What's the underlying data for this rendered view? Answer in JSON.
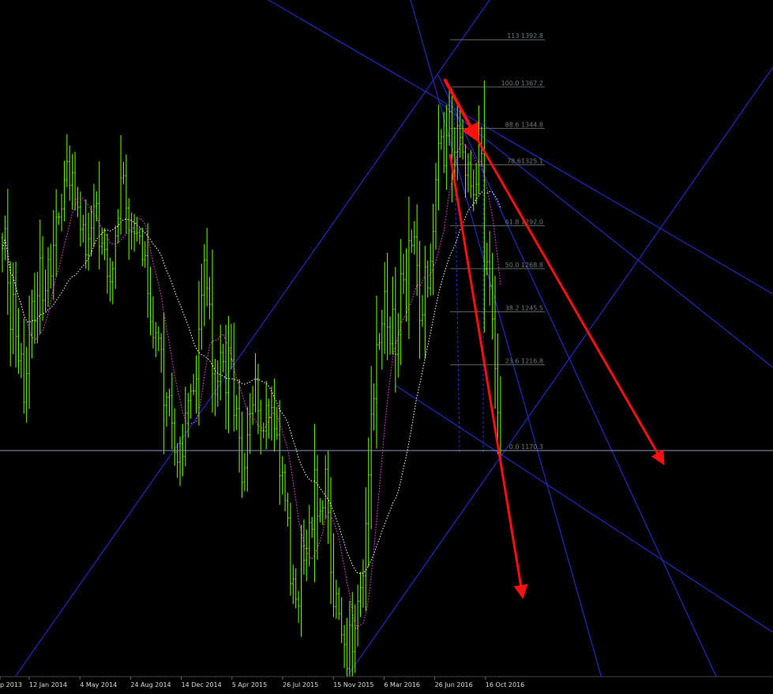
{
  "colors": {
    "background": "#000000",
    "candle": "#7CFC00",
    "ma_fast": "#FF40FF",
    "ma_slow": "#FFFFFF",
    "trendlines": "#2233DD",
    "fib_levels": "#5A6A6A",
    "fib_text": "#6B7B7B",
    "arrows": "#FF1010",
    "price_line": "#8899BB",
    "axis_text": "#DDDDDD"
  },
  "time_axis": {
    "labels": [
      "p 2013",
      "12 Jan 2014",
      "4 May 2014",
      "24 Aug 2014",
      "14 Dec 2014",
      "5 Apr 2015",
      "26 Jul 2015",
      "15 Nov 2015",
      "6 Mar 2016",
      "26 Jun 2016",
      "16 Oct 2016"
    ]
  },
  "chart_data": {
    "type": "candlestick",
    "timeframe": "weekly",
    "price_series": [
      1279.5,
      1290.4,
      1261.1,
      1236.0,
      1254.9,
      1232.1,
      1218.9,
      1222.5,
      1196.5,
      1212.0,
      1233.0,
      1251.1,
      1240.4,
      1254.1,
      1274.6,
      1251.7,
      1256.9,
      1273.9,
      1264.8,
      1281.5,
      1296.8,
      1296.7,
      1301.2,
      1316.8,
      1326.8,
      1314.0,
      1320.7,
      1306.4,
      1302.1,
      1290.1,
      1292.6,
      1276.3,
      1285.0,
      1290.9,
      1302.6,
      1304.1,
      1280.8,
      1282.7,
      1279.2,
      1264.8,
      1261.7,
      1268.7,
      1286.6,
      1296.0,
      1318.0,
      1319.1,
      1301.6,
      1289.7,
      1288.8,
      1287.8,
      1288.4,
      1286.4,
      1273.6,
      1275.8,
      1255.4,
      1240.1,
      1231.5,
      1234.1,
      1231.1,
      1225.1,
      1194.8,
      1199.1,
      1200.1,
      1185.1,
      1169.4,
      1164.1,
      1174.0,
      1167.2,
      1190.5,
      1197.4,
      1202.5,
      1202.6,
      1209.1,
      1236.1,
      1254.4,
      1273.5,
      1258.3,
      1249.5,
      1211.9,
      1200.7,
      1207.8,
      1223.4,
      1218.5,
      1201.7,
      1225.9,
      1219.4,
      1189.3,
      1193.0,
      1177.1,
      1153.2,
      1160.9,
      1178.8,
      1190.4,
      1195.0,
      1208.5,
      1191.8,
      1181.1,
      1180.9,
      1194.7,
      1188.1,
      1193.6,
      1182.2,
      1178.8,
      1156.7,
      1158.5,
      1143.3,
      1133.7,
      1098.2,
      1100.7,
      1089.9,
      1086.1,
      1118.5,
      1110.9,
      1117.3,
      1131.3,
      1127.7,
      1159.9,
      1134.8,
      1137.5,
      1139.3,
      1160.2,
      1136.9,
      1104.4,
      1085.7,
      1092.8,
      1081.9,
      1070.6,
      1065.1,
      1052.3,
      1075.7,
      1061.4,
      1074.1,
      1088.7,
      1096.0,
      1102.4,
      1130.7,
      1157.1,
      1190.0,
      1198.4,
      1227.6,
      1228.7,
      1238.9,
      1256.6,
      1237.2,
      1228.2,
      1246.8,
      1222.4,
      1233.1,
      1266.1,
      1262.8,
      1248.0,
      1284.0,
      1281.4,
      1286.0,
      1270.6,
      1240.8,
      1243.8,
      1269.7,
      1258.3,
      1272.7,
      1289.0,
      1317.0,
      1336.7,
      1340.2,
      1324.7,
      1340.8,
      1353.7,
      1325.5,
      1331.9,
      1346.1,
      1339.8,
      1332.0,
      1319.4,
      1326.0,
      1313.6,
      1308.9,
      1314.5,
      1336.0,
      1331.1,
      1268.7,
      1272.5,
      1259.5,
      1241.6,
      1214.7,
      1190.8,
      1170.3
    ],
    "series": [
      {
        "name": "MA fast (dotted magenta)"
      },
      {
        "name": "MA slow (dotted white)"
      }
    ],
    "ylim": [
      1040,
      1400
    ],
    "annotations": {
      "current_price": 1170.3,
      "fibonacci_levels": [
        {
          "label": "113 1392.8",
          "value": 1392.8
        },
        {
          "label": "100.0 1367.2",
          "value": 1367.2
        },
        {
          "label": "88.6 1344.8",
          "value": 1344.8
        },
        {
          "label": "78.61325.1",
          "value": 1325.1
        },
        {
          "label": "61.8 1292.0",
          "value": 1292.0
        },
        {
          "label": "50.0 1268.8",
          "value": 1268.8
        },
        {
          "label": "38.2 1245.5",
          "value": 1245.5
        },
        {
          "label": "23.6 1216.8",
          "value": 1216.8
        },
        {
          "label": "0.0 1170.3",
          "value": 1170.3
        }
      ],
      "red_arrows": 3,
      "blue_trendlines": 7
    },
    "grid": false,
    "legend": "none"
  }
}
